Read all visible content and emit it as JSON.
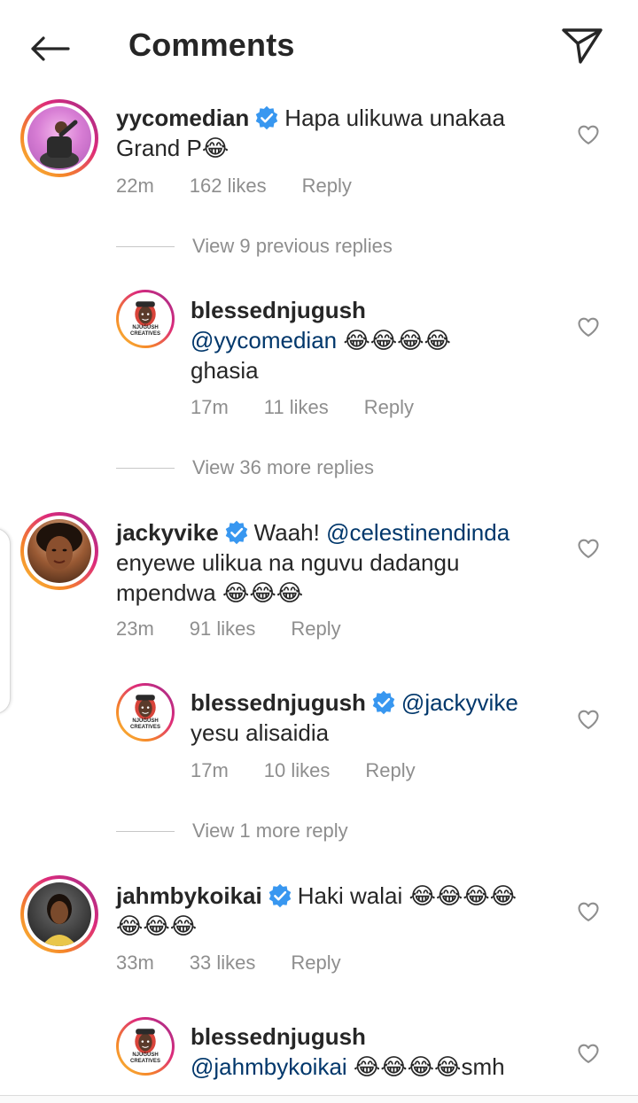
{
  "header": {
    "title": "Comments",
    "back_icon": "arrow-left-icon",
    "send_icon": "paper-plane-icon"
  },
  "colors": {
    "mention": "#00376b",
    "secondary": "#8e8e8e",
    "verified": "#3897f0",
    "text": "#262626"
  },
  "comments": [
    {
      "username": "yycomedian",
      "verified": true,
      "text": "Hapa ulikuwa unakaa Grand P😂",
      "time": "22m",
      "likes": "162 likes",
      "reply": "Reply",
      "view_replies": "View 9 previous replies",
      "replies": [
        {
          "username": "blessednjugush",
          "verified": false,
          "mention": "@yycomedian",
          "text": "😂😂😂😂",
          "text2": "ghasia",
          "time": "17m",
          "likes": "11 likes",
          "reply": "Reply",
          "avatar_text": "NJUGUSH CREATIVES"
        }
      ],
      "view_more": "View 36 more replies"
    },
    {
      "username": "jackyvike",
      "verified": true,
      "text_pre": "Waah! ",
      "mention": "@celestinendinda",
      "text_line2": "enyewe ulikua na nguvu dadangu",
      "text_line3": "mpendwa 😂😂😂",
      "time": "23m",
      "likes": "91 likes",
      "reply": "Reply",
      "replies": [
        {
          "username": "blessednjugush",
          "verified": true,
          "mention": "@jackyvike",
          "text": "yesu alisaidia",
          "time": "17m",
          "likes": "10 likes",
          "reply": "Reply",
          "avatar_text": "NJUGUSH CREATIVES"
        }
      ],
      "view_more": "View 1 more reply"
    },
    {
      "username": "jahmbykoikai",
      "verified": true,
      "text": "Haki walai 😂😂😂😂",
      "text2": "😂😂😂",
      "time": "33m",
      "likes": "33 likes",
      "reply": "Reply",
      "replies": [
        {
          "username": "blessednjugush",
          "verified": false,
          "mention": "@jahmbykoikai",
          "text": "😂😂😂😂smh",
          "avatar_text": "NJUGUSH CREATIVES"
        }
      ]
    }
  ]
}
